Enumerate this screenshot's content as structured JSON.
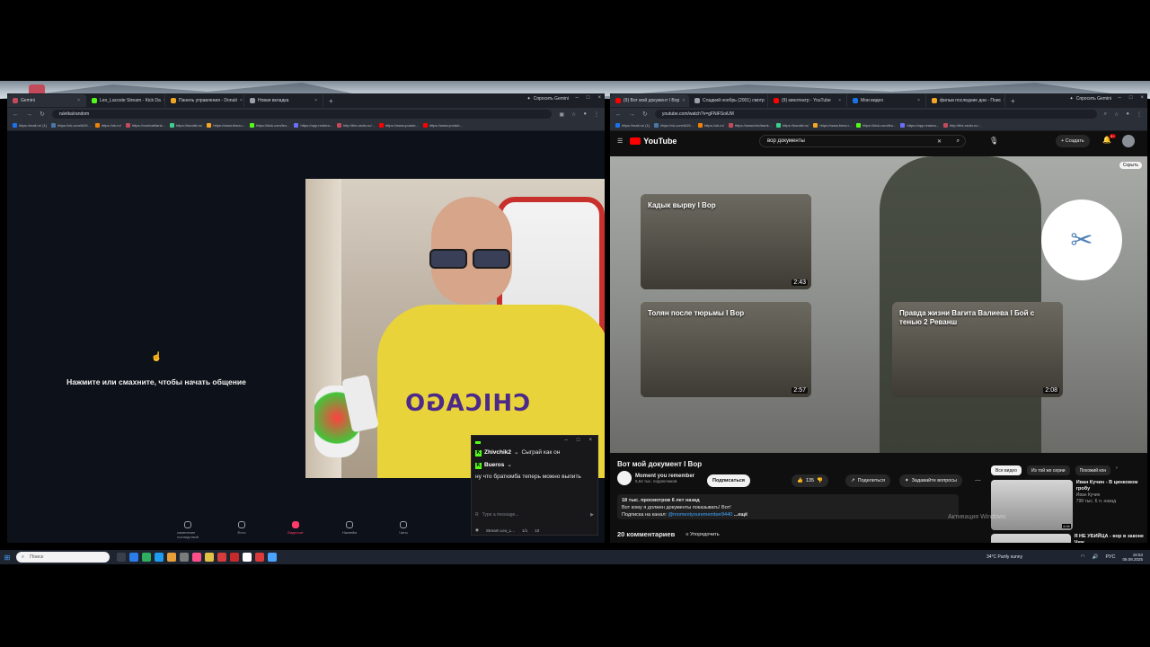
{
  "left_browser": {
    "tabs": [
      {
        "title": "Gemini",
        "active": true,
        "color": "#c24a5a"
      },
      {
        "title": "Leo_Lacoste Stream - Kick Da",
        "active": false,
        "color": "#53fc18"
      },
      {
        "title": "Панель управления - Donati",
        "active": false,
        "color": "#f5a623"
      },
      {
        "title": "Новая вкладка",
        "active": false,
        "color": "#9aa0a8"
      }
    ],
    "new_tab": "+",
    "gemini_label": "Спросить Gemini",
    "url": "ruletka/random",
    "bookmarks": [
      {
        "label": "https://mail.ru/ (1)",
        "color": "#1a73e8"
      },
      {
        "label": "https://vk.com/id19...",
        "color": "#4a76a8"
      },
      {
        "label": "https://ok.ru/",
        "color": "#ee8208"
      },
      {
        "label": "https://vombat/tank...",
        "color": "#c24a5a"
      },
      {
        "label": "https://koraiki.ru/",
        "color": "#3ccf8e"
      },
      {
        "label": "https://www.bima.r...",
        "color": "#f5a623"
      },
      {
        "label": "https://kick.com/leo...",
        "color": "#53fc18"
      },
      {
        "label": "https://app.restrea...",
        "color": "#6a6ef8"
      },
      {
        "label": "http://the-radio.ru/...",
        "color": "#c24a5a"
      },
      {
        "label": "https://www.youtub...",
        "color": "#ff0000"
      },
      {
        "label": "https://www.youtub...",
        "color": "#ff0000"
      }
    ],
    "cta_text": "Нажмите или смахните, чтобы начать общение",
    "nav": [
      {
        "label": "изменение последствий",
        "active": false
      },
      {
        "label": "Фото",
        "active": false
      },
      {
        "label": "Видеочат",
        "active": true
      },
      {
        "label": "Никнейм",
        "active": false
      },
      {
        "label": "Чаты",
        "active": false
      }
    ],
    "webcam_shirt_text": "CHICAGO"
  },
  "chat": {
    "messages": [
      {
        "user": "Zhivchik2",
        "text": "Сыграй как он"
      },
      {
        "user": "Bueros",
        "text": "ну что братюмба теперь можно выпить"
      }
    ],
    "input_placeholder": "Type a message...",
    "footer_stream": "Stream Leo_L...",
    "footer_count1": "1/1",
    "footer_count2": "10"
  },
  "right_browser": {
    "tabs": [
      {
        "title": "(9) Вот мой документ I Вор",
        "active": true,
        "color": "#ff0000"
      },
      {
        "title": "Сладкий ноябрь (2001) смотр",
        "active": false,
        "color": "#9aa0a8"
      },
      {
        "title": "(9) кинотеатр - YouTube",
        "active": false,
        "color": "#ff0000"
      },
      {
        "title": "Мои видео",
        "active": false,
        "color": "#1a73e8"
      },
      {
        "title": "фильм последние дни - Поис",
        "active": false,
        "color": "#f5a623"
      }
    ],
    "gemini_label": "Спросить Gemini",
    "url": "youtube.com/watch?v=gFNiFSoiUM",
    "bookmarks": [
      {
        "label": "https://mail.ru/ (1)",
        "color": "#1a73e8"
      },
      {
        "label": "https://vk.com/id19...",
        "color": "#4a76a8"
      },
      {
        "label": "https://ok.ru/",
        "color": "#ee8208"
      },
      {
        "label": "https://www.bbc/bank...",
        "color": "#c24a5a"
      },
      {
        "label": "https://koraiki.ru/",
        "color": "#3ccf8e"
      },
      {
        "label": "https://www.bima.r...",
        "color": "#f5a623"
      },
      {
        "label": "https://kick.com/leo...",
        "color": "#53fc18"
      },
      {
        "label": "https://app.restrea...",
        "color": "#6a6ef8"
      },
      {
        "label": "http://the-radio.ru/...",
        "color": "#c24a5a"
      }
    ]
  },
  "youtube": {
    "logo": "YouTube",
    "search_query": "вор документы",
    "create_label": "Создать",
    "notifications_badge": "9+",
    "hide_label": "Скрыть",
    "end_cards": [
      {
        "title": "Кадык вырву I Вор",
        "duration": "2:43"
      },
      {
        "title": "Толян после тюрьмы I Вор",
        "duration": "2:57"
      },
      {
        "title": "Правда жизни Вагита Валиева I Бой с тенью 2 Реванш",
        "duration": "2:08"
      }
    ],
    "video_title": "Вот мой документ I Вор",
    "channel_name": "Moment you remember",
    "channel_subs": "5,54 тыс. подписчиков",
    "subscribe_label": "Подписаться",
    "likes": "135",
    "share_label": "Поделиться",
    "ask_label": "Задавайте вопросы",
    "desc_stats": "18 тыс. просмотров  6 лет назад",
    "desc_line1": "Вот кому я должен документы показывать! Вот!",
    "desc_line2_prefix": "Подписка на канал:",
    "desc_link": "@momentyouremember8440",
    "desc_more": "...ещё",
    "comments_label": "20 комментариев",
    "sort_label": "Упорядочить",
    "chips": [
      {
        "label": "Все видео",
        "on": true
      },
      {
        "label": "Из той же серии",
        "on": false
      },
      {
        "label": "Похожий кон",
        "on": false
      }
    ],
    "side_videos": [
      {
        "title": "Иван Кучин - В цинковом гробу",
        "channel": "Иван Кучин",
        "stats": "798 тыс. 6 л. назад",
        "duration": "4:06"
      },
      {
        "title": "Я НЕ УБИЙЦА - вор в законе Чиж",
        "channel": "",
        "stats": "",
        "duration": ""
      }
    ],
    "activation_watermark": "Активация Windows"
  },
  "taskbar": {
    "search_placeholder": "Поиск",
    "weather": "34°C  Partly sunny",
    "lang": "РУС",
    "time": "16:53",
    "date": "06.08.2025"
  }
}
